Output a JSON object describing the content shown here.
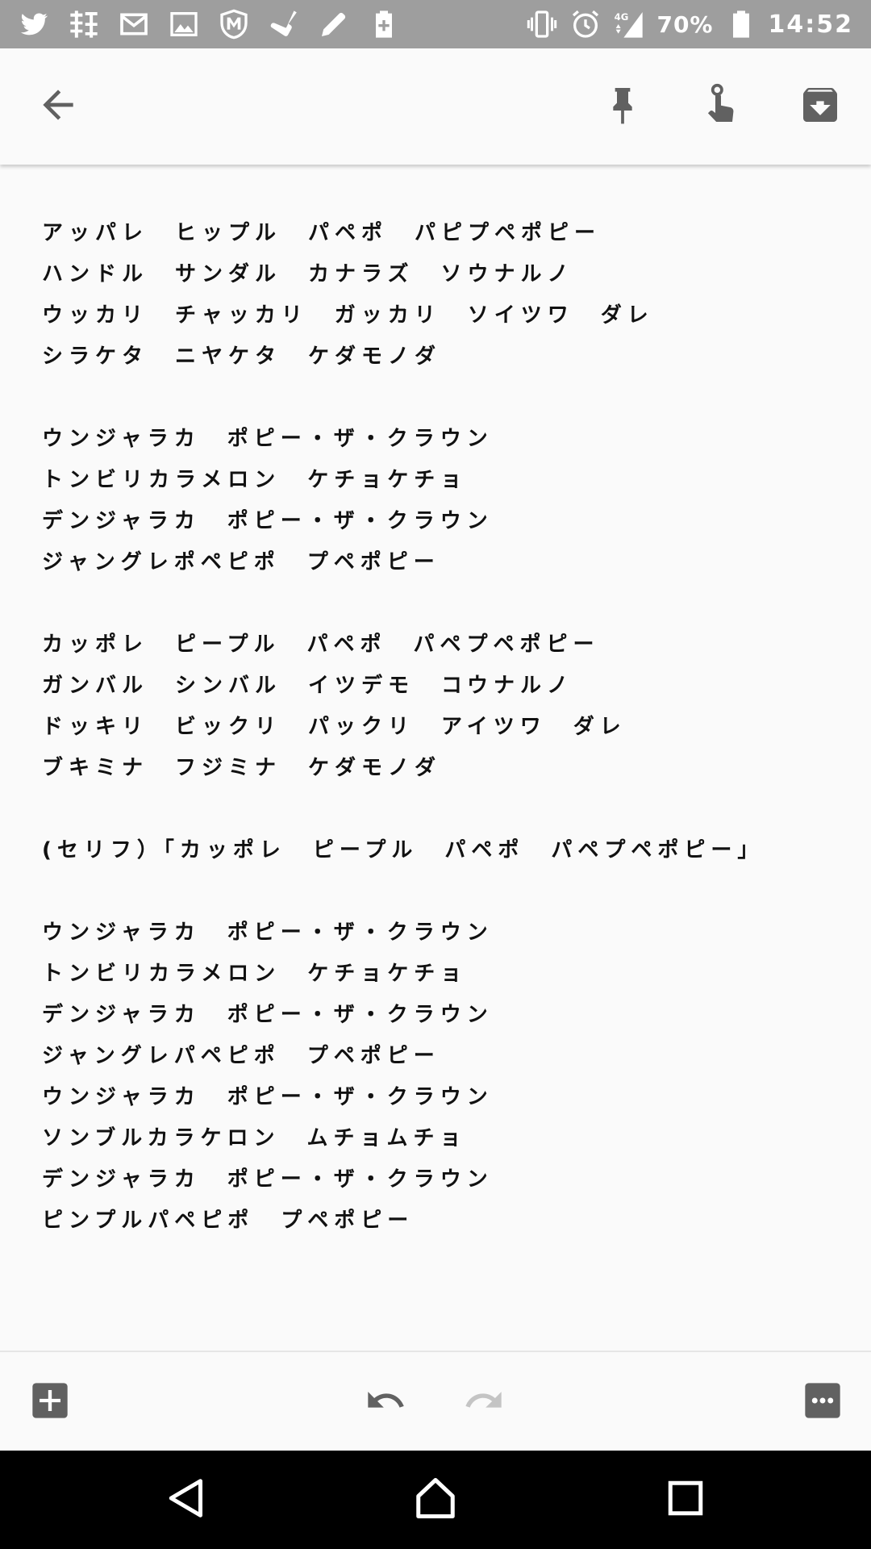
{
  "status_bar": {
    "left_icons": [
      "twitter-icon",
      "kanji-app-icon",
      "gmail-icon",
      "gallery-icon",
      "m-shield-icon",
      "broom-icon",
      "pencil-icon",
      "battery-saver-icon"
    ],
    "network": "4G",
    "battery": "70%",
    "time": "14:52"
  },
  "toolbar": {
    "back": "arrow-back-icon",
    "pin": "pin-icon",
    "reminder": "reminder-hand-icon",
    "archive": "archive-icon"
  },
  "note": {
    "lines": [
      "アッパレ　ヒップル　パペポ　パピプペポピー",
      "ハンドル　サンダル　カナラズ　ソウナルノ",
      "ウッカリ　チャッカリ　ガッカリ　ソイツワ　ダレ",
      "シラケタ　ニヤケタ　ケダモノダ",
      "",
      "ウンジャラカ　ポピー・ザ・クラウン",
      "トンビリカラメロン　ケチョケチョ",
      "デンジャラカ　ポピー・ザ・クラウン",
      "ジャングレポペピポ　プペポピー",
      "",
      "カッポレ　ピープル　パペポ　パペプペポピー",
      "ガンバル　シンバル　イツデモ　コウナルノ",
      "ドッキリ　ビックリ　パックリ　アイツワ　ダレ",
      "ブキミナ　フジミナ　ケダモノダ",
      "",
      "(セリフ）「カッポレ　ピープル　パペポ　パペプペポピー」",
      "",
      "ウンジャラカ　ポピー・ザ・クラウン",
      "トンビリカラメロン　ケチョケチョ",
      "デンジャラカ　ポピー・ザ・クラウン",
      "ジャングレパペピポ　プペポピー",
      "ウンジャラカ　ポピー・ザ・クラウン",
      "ソンブルカラケロン　ムチョムチョ",
      "デンジャラカ　ポピー・ザ・クラウン",
      "ピンプルパペピポ　プペポピー"
    ]
  },
  "bottom_bar": {
    "add": "add-box-icon",
    "undo": "undo-icon",
    "redo": "redo-icon",
    "more": "more-icon"
  },
  "nav_bar": {
    "back": "nav-back-icon",
    "home": "nav-home-icon",
    "recents": "nav-recents-icon"
  },
  "colors": {
    "status_bar": "#9e9e9e",
    "background": "#fafafa",
    "icon": "#616161",
    "text": "#111111",
    "nav_bar": "#000000"
  }
}
